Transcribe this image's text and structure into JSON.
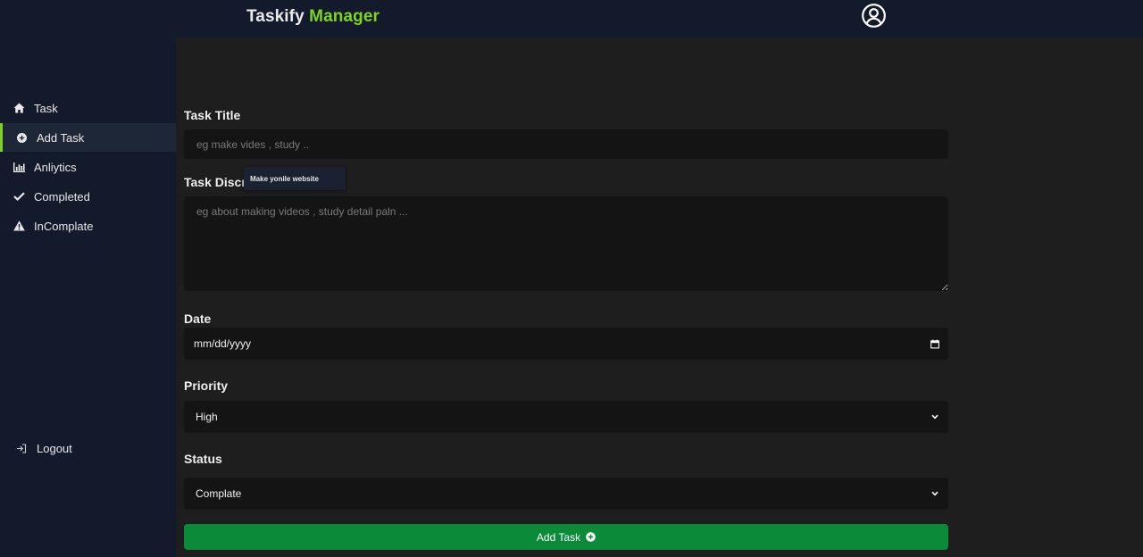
{
  "app": {
    "brand_main": "Taskify",
    "brand_accent": "Manager",
    "accent_color": "#7ed321"
  },
  "sidebar": {
    "items": [
      {
        "label": "Task",
        "icon": "home-icon"
      },
      {
        "label": "Add Task",
        "icon": "plus-circle-icon",
        "active": true
      },
      {
        "label": "Anliytics",
        "icon": "bar-chart-icon"
      },
      {
        "label": "Completed",
        "icon": "check-icon"
      },
      {
        "label": "InComplate",
        "icon": "warning-icon"
      }
    ],
    "logout_label": "Logout"
  },
  "form": {
    "title_label": "Task Title",
    "title_placeholder": "eg make vides , study ..",
    "description_label": "Task Discription",
    "description_placeholder": "eg about making videos , study detail paln ...",
    "tooltip_text": "Make yonile website",
    "date_label": "Date",
    "date_value": "mm/dd/yyyy",
    "priority_label": "Priority",
    "priority_value": "High",
    "status_label": "Status",
    "status_value": "Complate",
    "submit_label": "Add Task"
  }
}
